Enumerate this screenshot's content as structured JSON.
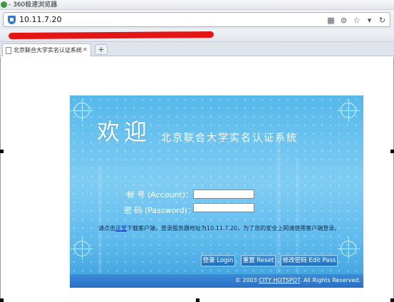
{
  "browser": {
    "title": "- 360极速浏览器",
    "url": "10.11.7.20",
    "tab_label": "北京联合大学实名认证系统",
    "tab_close": "×",
    "new_tab": "+"
  },
  "page": {
    "welcome": "欢迎",
    "system_name": "北京联合大学实名认证系统",
    "account_label": "帐 号 (Account)：",
    "password_label": "密 码 (Password)：",
    "account_value": "",
    "password_value": "",
    "notice_prefix": "请点击",
    "notice_link": "这里",
    "notice_suffix": "下载客户端，登录服务器地址为10.11.7.20，为了您的安全上网请使用客户端登录。",
    "login_button": "登录 Login",
    "reset_button": "重置 Reset",
    "change_password_button": "修改密码 Edit Pass",
    "footer_prefix": "© 2003 ",
    "footer_link": "CITY HOTSPOT",
    "footer_suffix": ". All Rights Reserved."
  },
  "colors": {
    "panel_blue": "#56b8ea",
    "button_blue": "#1e6cc0",
    "redaction": "#e31515"
  }
}
